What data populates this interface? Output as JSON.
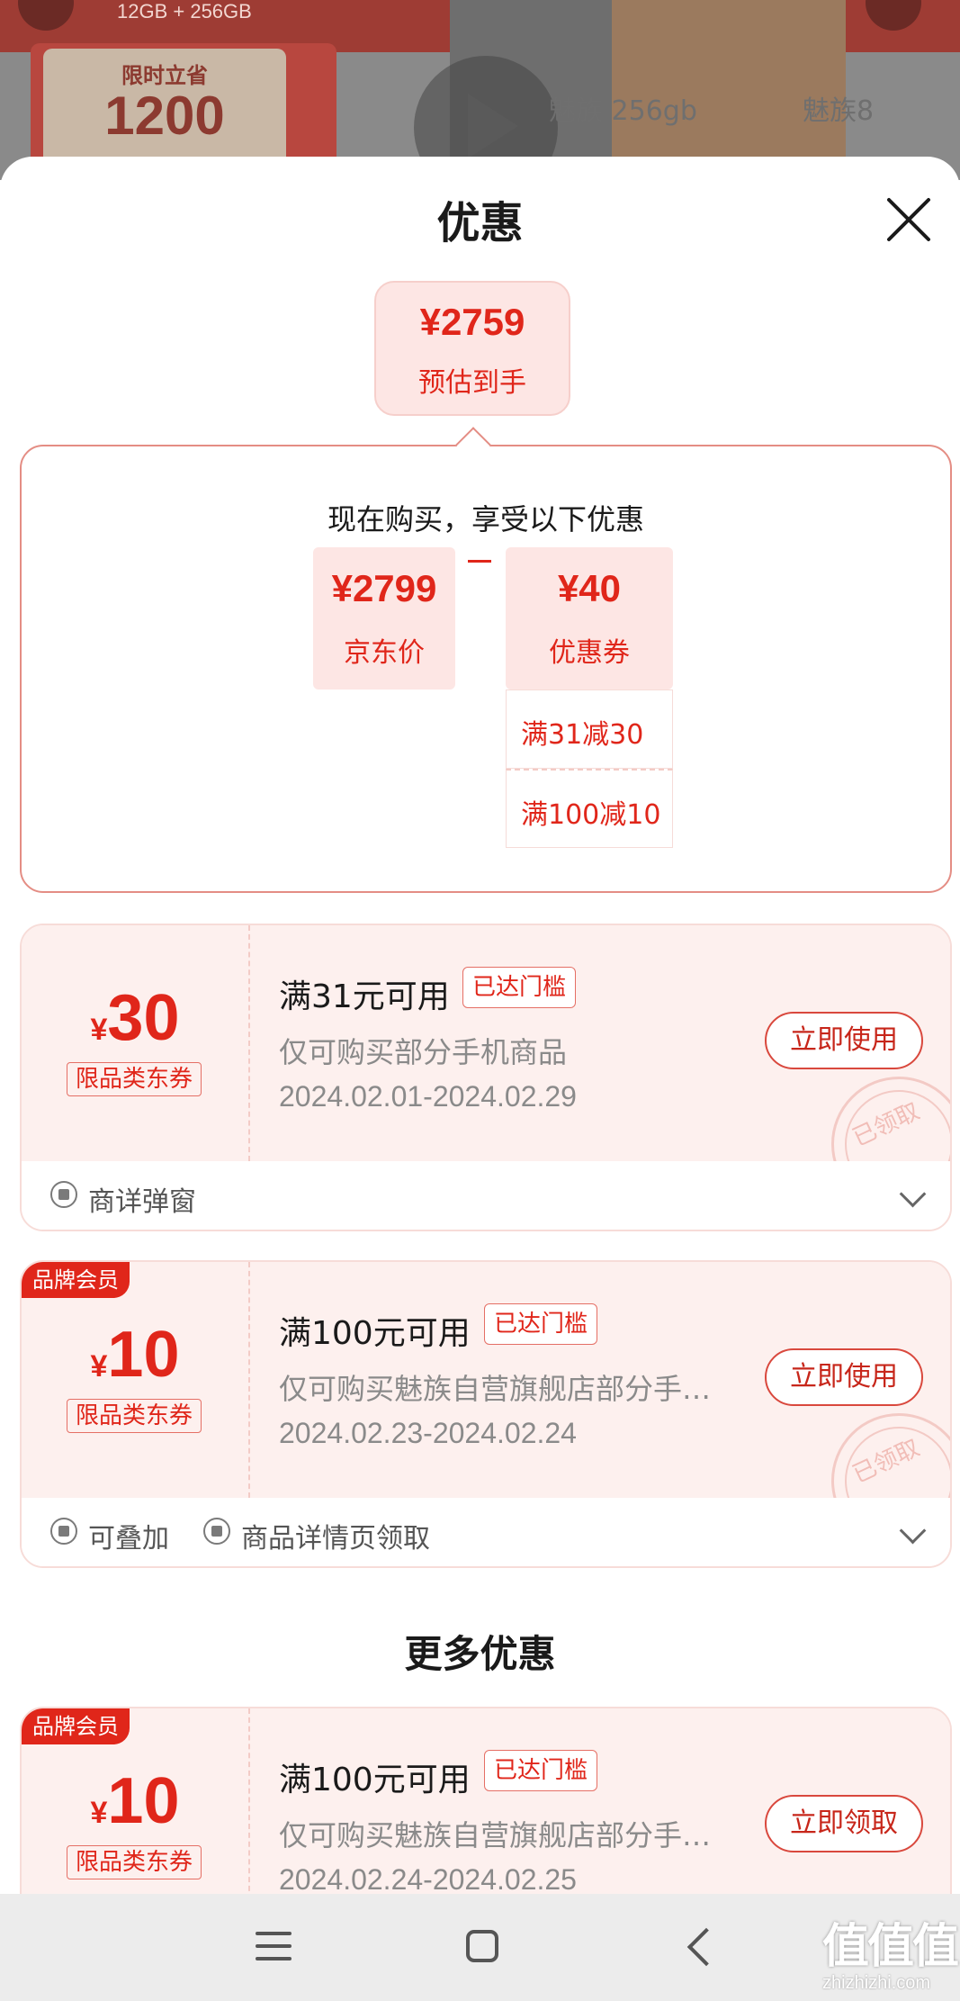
{
  "background": {
    "spec": "12GB + 256GB",
    "promo_label": "限时立省",
    "promo_amount": "1200",
    "tabs": [
      "魅族 256gb",
      "魅族8"
    ]
  },
  "sheet": {
    "title": "优惠",
    "estimate": {
      "price": "¥2759",
      "label": "预估到手"
    },
    "breakdown": {
      "heading": "现在购买，享受以下优惠",
      "jd_price": {
        "price": "¥2799",
        "label": "京东价"
      },
      "coupon": {
        "price": "¥40",
        "label": "优惠券"
      },
      "coupon_items": [
        "满31减30",
        "满100减10"
      ]
    },
    "coupons": [
      {
        "brand_tag": "",
        "currency": "¥",
        "amount": "30",
        "type": "限品类东券",
        "condition": "满31元可用",
        "badge": "已达门槛",
        "desc": "仅可购买部分手机商品",
        "date": "2024.02.01-2024.02.29",
        "action": "立即使用",
        "stamp": "已领取",
        "footer": [
          "商详弹窗"
        ]
      },
      {
        "brand_tag": "品牌会员",
        "currency": "¥",
        "amount": "10",
        "type": "限品类东券",
        "condition": "满100元可用",
        "badge": "已达门槛",
        "desc": "仅可购买魅族自营旗舰店部分手…",
        "date": "2024.02.23-2024.02.24",
        "action": "立即使用",
        "stamp": "已领取",
        "footer": [
          "可叠加",
          "商品详情页领取"
        ]
      }
    ],
    "more_title": "更多优惠",
    "more_coupons": [
      {
        "brand_tag": "品牌会员",
        "currency": "¥",
        "amount": "10",
        "type": "限品类东券",
        "condition": "满100元可用",
        "badge": "已达门槛",
        "desc": "仅可购买魅族自营旗舰店部分手…",
        "date": "2024.02.24-2024.02.25",
        "action": "立即领取"
      }
    ]
  },
  "watermark": {
    "logo": "值值值",
    "url": "zhizhizhi.com"
  },
  "colors": {
    "accent": "#e0261a",
    "card_bg": "#fdf0ee",
    "badge_bg": "#fde6e4"
  }
}
